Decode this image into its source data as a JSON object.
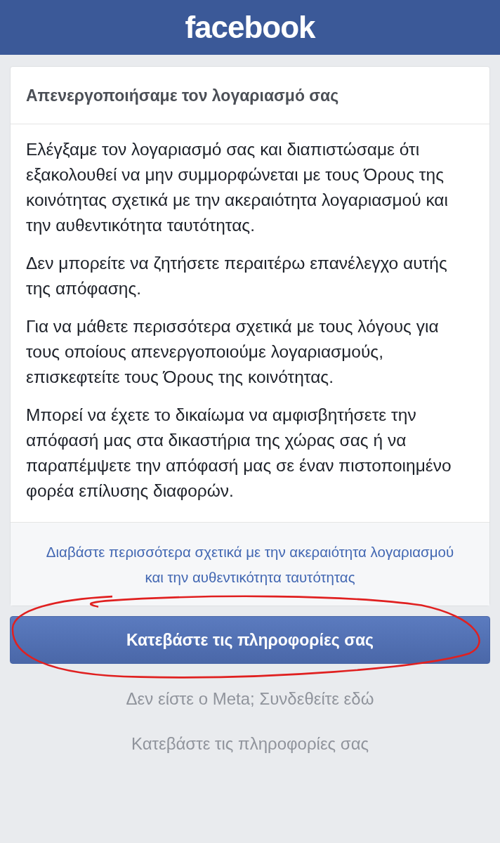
{
  "header": {
    "logo": "facebook"
  },
  "card": {
    "title": "Απενεργοποιήσαμε τον λογαριασμό σας",
    "paragraphs": [
      "Ελέγξαμε τον λογαριασμό σας και διαπιστώσαμε ότι εξακολουθεί να μην συμμορφώνεται με τους Όρους της κοινότητας σχετικά με την ακεραιότητα λογαριασμού και την αυθεντικότητα ταυτότητας.",
      "Δεν μπορείτε να ζητήσετε περαιτέρω επανέλεγχο αυτής της απόφασης.",
      "Για να μάθετε περισσότερα σχετικά με τους λόγους για τους οποίους απενεργοποιούμε λογαριασμούς, επισκεφτείτε τους Όρους της κοινότητας.",
      "Μπορεί να έχετε το δικαίωμα να αμφισβητήσετε την απόφασή μας στα δικαστήρια της χώρας σας ή να παραπέμψετε την απόφασή μας σε έναν πιστοποιημένο φορέα επίλυσης διαφορών."
    ],
    "link": "Διαβάστε περισσότερα σχετικά με την ακεραιότητα λογαριασμού και την αυθεντικότητα ταυτότητας"
  },
  "primary_button": "Κατεβάστε τις πληροφορίες σας",
  "secondary_links": [
    "Δεν είστε ο Meta; Συνδεθείτε εδώ",
    "Κατεβάστε τις πληροφορίες σας"
  ]
}
